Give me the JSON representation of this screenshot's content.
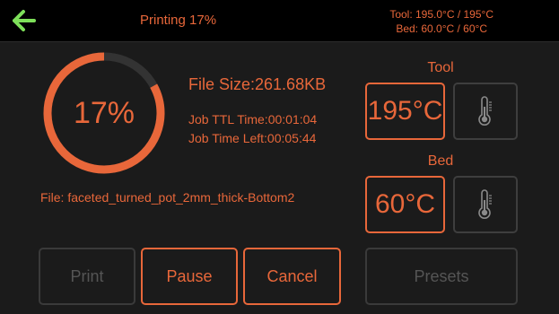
{
  "header": {
    "status": "Printing 17%",
    "tool_temp": "Tool: 195.0°C / 195°C",
    "bed_temp": "Bed: 60.0°C / 60°C"
  },
  "progress": {
    "fraction": 0.17,
    "label": "17%"
  },
  "job": {
    "file_size": "File Size:261.68KB",
    "ttl_time": "Job TTL Time:00:01:04",
    "time_left": "Job Time Left:00:05:44",
    "file_name": "File: faceted_turned_pot_2mm_thick-Bottom2"
  },
  "tool": {
    "label": "Tool",
    "temp": "195°C"
  },
  "bed": {
    "label": "Bed",
    "temp": "60°C"
  },
  "buttons": {
    "print": "Print",
    "pause": "Pause",
    "cancel": "Cancel",
    "presets": "Presets"
  },
  "colors": {
    "accent": "#e8673a",
    "back_arrow": "#7ee05a",
    "disabled": "#555555",
    "background": "#1b1b1b"
  },
  "icons": {
    "back": "arrow-left-icon",
    "thermometer": "thermometer-icon"
  }
}
